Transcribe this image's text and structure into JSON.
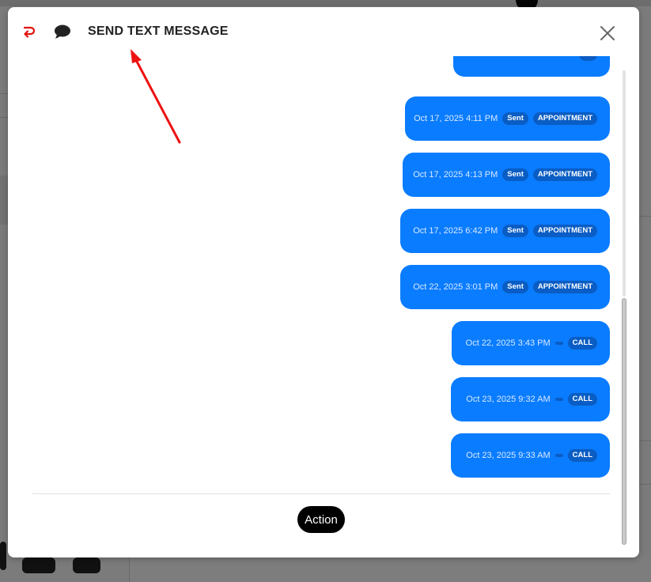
{
  "modal": {
    "title": "SEND TEXT MESSAGE",
    "back_icon": "back-arrow-icon",
    "chat_icon": "chat-bubble-icon",
    "close_icon": "close-icon",
    "action_label": "Action"
  },
  "colors": {
    "accent_blue": "#0a7cff",
    "badge_blue": "#0a5dc4",
    "back_icon_red": "#e3120b",
    "annotation_red": "#ee1111"
  },
  "messages": [
    {
      "time": "",
      "status": "",
      "tag": ""
    },
    {
      "time": "Oct 17, 2025 4:11 PM",
      "status": "Sent",
      "tag": "APPOINTMENT"
    },
    {
      "time": "Oct 17, 2025 4:13 PM",
      "status": "Sent",
      "tag": "APPOINTMENT"
    },
    {
      "time": "Oct 17, 2025 6:42 PM",
      "status": "Sent",
      "tag": "APPOINTMENT"
    },
    {
      "time": "Oct 22, 2025 3:01 PM",
      "status": "Sent",
      "tag": "APPOINTMENT"
    },
    {
      "time": "Oct 22, 2025 3:43 PM",
      "status": "",
      "tag": "CALL"
    },
    {
      "time": "Oct 23, 2025 9:32 AM",
      "status": "",
      "tag": "CALL"
    },
    {
      "time": "Oct 23, 2025 9:33 AM",
      "status": "",
      "tag": "CALL"
    }
  ]
}
